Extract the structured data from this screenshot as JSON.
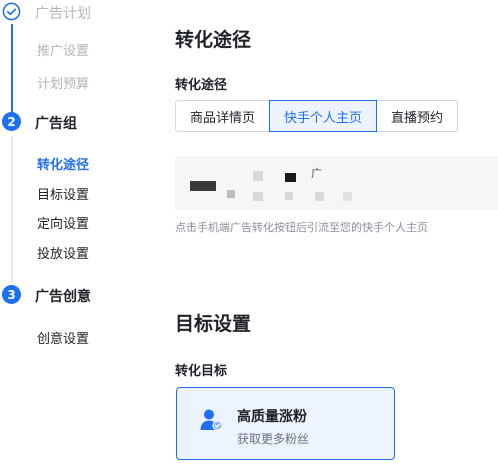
{
  "sidebar": {
    "step1": {
      "title": "广告计划",
      "items": [
        "推广设置",
        "计划预算"
      ]
    },
    "step2": {
      "number": "2",
      "title": "广告组",
      "items": [
        "转化途径",
        "目标设置",
        "定向设置",
        "投放设置"
      ]
    },
    "step3": {
      "number": "3",
      "title": "广告创意",
      "items": [
        "创意设置"
      ]
    }
  },
  "conversion": {
    "section_title": "转化途径",
    "field_label": "转化途径",
    "options": [
      "商品详情页",
      "快手个人主页",
      "直播预约"
    ],
    "selected": "快手个人主页",
    "hint": "点击手机端广告转化按钮后引流至您的快手个人主页",
    "profile_mark": "广"
  },
  "goal": {
    "section_title": "目标设置",
    "field_label": "转化目标",
    "card_title": "高质量涨粉",
    "card_subtitle": "获取更多粉丝",
    "icon": "user-check-icon"
  },
  "colors": {
    "accent": "#1f6ff2",
    "accent_light": "#eef4ff"
  }
}
